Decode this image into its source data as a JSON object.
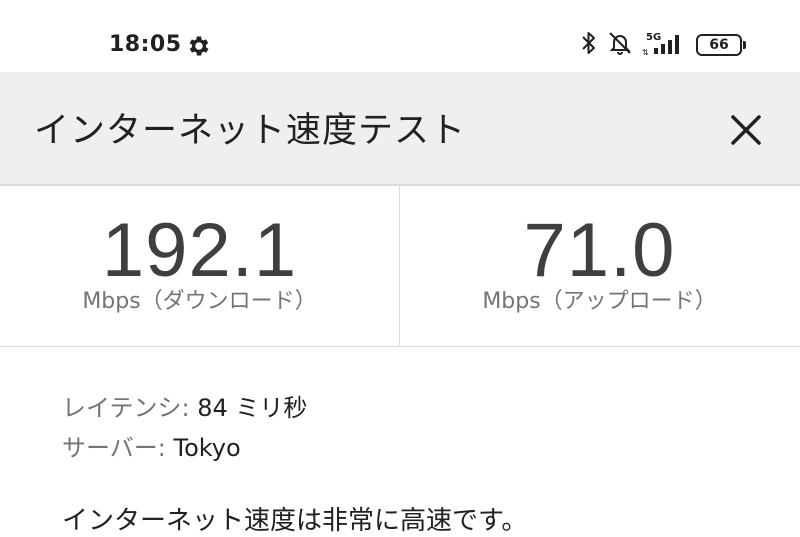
{
  "status_bar": {
    "time": "18:05",
    "icons": [
      "gear-icon",
      "bluetooth-icon",
      "notifications-off-icon",
      "5g-signal-icon"
    ],
    "network": "5G",
    "battery": "66"
  },
  "header": {
    "title": "インターネット速度テスト",
    "close_icon": "close-icon"
  },
  "results": {
    "download": {
      "value": "192.1",
      "unit": "Mbps（ダウンロード）"
    },
    "upload": {
      "value": "71.0",
      "unit": "Mbps（アップロード）"
    }
  },
  "details": {
    "latency_label": "レイテンシ:",
    "latency_value": "84 ミリ秒",
    "server_label": "サーバー:",
    "server_value": "Tokyo"
  },
  "summary": "インターネット速度は非常に高速です。",
  "colors": {
    "header_bg": "#eeeff1",
    "value_text": "#3c4043",
    "muted_text": "#70757a",
    "divider": "#dadce0"
  }
}
